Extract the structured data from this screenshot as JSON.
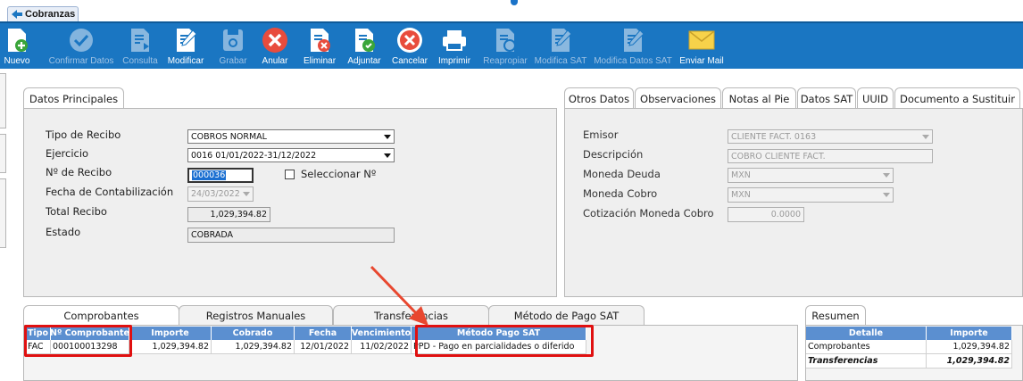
{
  "window": {
    "tab_title": "Cobranzas"
  },
  "toolbar": [
    {
      "label": "Nuevo",
      "icon": "new-doc-icon",
      "enabled": true
    },
    {
      "label": "Confirmar Datos",
      "icon": "check-circle-icon",
      "enabled": false
    },
    {
      "label": "Consulta",
      "icon": "doc-search-icon",
      "enabled": false
    },
    {
      "label": "Modificar",
      "icon": "doc-edit-icon",
      "enabled": true
    },
    {
      "label": "Grabar",
      "icon": "save-icon",
      "enabled": false
    },
    {
      "label": "Anular",
      "icon": "cancel-x-icon",
      "enabled": true
    },
    {
      "label": "Eliminar",
      "icon": "doc-delete-icon",
      "enabled": true
    },
    {
      "label": "Adjuntar",
      "icon": "doc-attach-icon",
      "enabled": true
    },
    {
      "label": "Cancelar",
      "icon": "cancel-circle-icon",
      "enabled": true
    },
    {
      "label": "Imprimir",
      "icon": "print-icon",
      "enabled": true
    },
    {
      "label": "Reapropiar",
      "icon": "doc-reassign-icon",
      "enabled": false
    },
    {
      "label": "Modifica SAT",
      "icon": "doc-edit-sat-icon",
      "enabled": false
    },
    {
      "label": "Modifica Datos SAT",
      "icon": "doc-edit-data-sat-icon",
      "enabled": false
    },
    {
      "label": "Enviar Mail",
      "icon": "mail-icon",
      "enabled": true
    }
  ],
  "datos_principales": {
    "tab": "Datos Principales",
    "tipo_recibo": {
      "label": "Tipo de Recibo",
      "value": "COBROS NORMAL"
    },
    "ejercicio": {
      "label": "Ejercicio",
      "value": "0016 01/01/2022-31/12/2022"
    },
    "nro_recibo": {
      "label": "Nº de Recibo",
      "value": "000036"
    },
    "seleccionar": {
      "label": "Seleccionar Nº"
    },
    "fecha_contab": {
      "label": "Fecha de Contabilización",
      "value": "24/03/2022"
    },
    "total_recibo": {
      "label": "Total Recibo",
      "value": "1,029,394.82"
    },
    "estado": {
      "label": "Estado",
      "value": "COBRADA"
    }
  },
  "otros_datos": {
    "tabs": [
      "Otros Datos",
      "Observaciones",
      "Notas al Pie",
      "Datos SAT",
      "UUID",
      "Documento a Sustituir"
    ],
    "emisor": {
      "label": "Emisor",
      "value": "CLIENTE FACT. 0163"
    },
    "descripcion": {
      "label": "Descripción",
      "value": "COBRO CLIENTE FACT."
    },
    "moneda_deuda": {
      "label": "Moneda Deuda",
      "value": "MXN"
    },
    "moneda_cobro": {
      "label": "Moneda Cobro",
      "value": "MXN"
    },
    "cotizacion": {
      "label": "Cotización Moneda Cobro",
      "value": "0.0000"
    }
  },
  "bottom_tabs": [
    "Comprobantes",
    "Registros Manuales",
    "Transferencias",
    "Método de Pago SAT"
  ],
  "comprobantes": {
    "headers": [
      "Tipo",
      "Nº Comprobante",
      "Importe",
      "Cobrado",
      "Fecha",
      "Vencimiento",
      "Método Pago SAT"
    ],
    "rows": [
      [
        "FAC",
        "000100013298",
        "1,029,394.82",
        "1,029,394.82",
        "12/01/2022",
        "11/02/2022",
        "PPD - Pago en parcialidades o diferido"
      ]
    ]
  },
  "resumen": {
    "tab": "Resumen",
    "headers": [
      "Detalle",
      "Importe"
    ],
    "rows": [
      [
        "Comprobantes",
        "1,029,394.82"
      ],
      [
        "Transferencias",
        "1,029,394.82"
      ]
    ]
  },
  "colors": {
    "toolbar": "#1a76c2",
    "highlight": "#e01010",
    "grid_header": "#5b8fd0"
  }
}
